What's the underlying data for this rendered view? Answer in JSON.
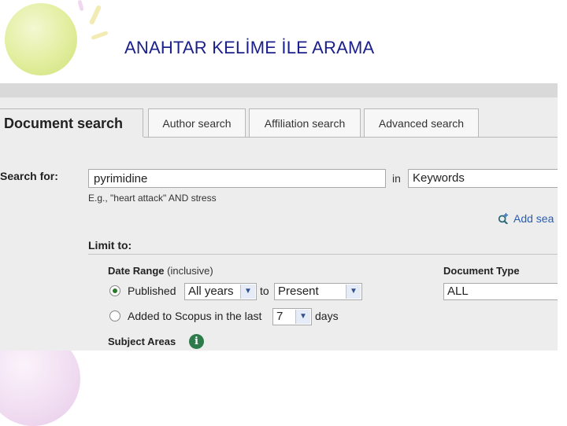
{
  "slide": {
    "title": "ANAHTAR KELİME İLE ARAMA"
  },
  "tabs": [
    {
      "label": "Document search"
    },
    {
      "label": "Author search"
    },
    {
      "label": "Affiliation search"
    },
    {
      "label": "Advanced search"
    }
  ],
  "search": {
    "label": "Search for:",
    "value": "pyrimidine",
    "in_label": "in",
    "field": "Keywords",
    "hint": "E.g., \"heart attack\" AND stress",
    "add_search": "Add sea"
  },
  "limits": {
    "label": "Limit to:",
    "date_range": "Date Range",
    "inclusive": "(inclusive)",
    "published": "Published",
    "from": "All years",
    "to_label": "to",
    "to": "Present",
    "added": "Added to Scopus in the last",
    "days_value": "7",
    "days_label": "days",
    "document_type_label": "Document Type",
    "document_type": "ALL",
    "subject_areas": "Subject Areas"
  },
  "icons": {
    "add": "magnifier-plus-icon",
    "info": "info-icon"
  },
  "colors": {
    "title": "#1a1f8a",
    "link": "#2a5db0"
  }
}
